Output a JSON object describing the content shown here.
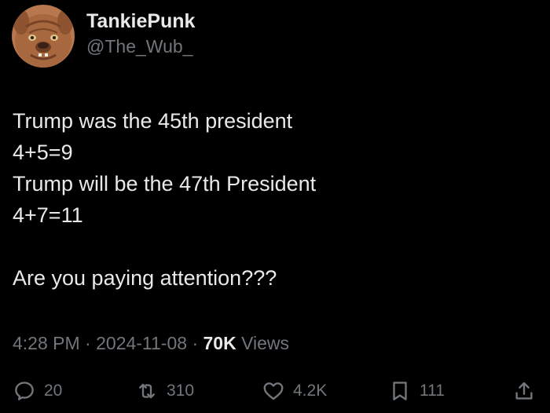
{
  "author": {
    "display_name": "TankiePunk",
    "handle": "@The_Wub_"
  },
  "tweet": {
    "lines": [
      "Trump was the 45th president",
      "4+5=9",
      "Trump will be the 47th President",
      "4+7=11",
      "",
      "Are you paying attention???"
    ]
  },
  "meta": {
    "time": "4:28 PM",
    "separator": "·",
    "date": "2024-11-08",
    "views_count": "70K",
    "views_label": "Views"
  },
  "actions": {
    "replies": "20",
    "reposts": "310",
    "likes": "4.2K",
    "bookmarks": "111"
  },
  "icons": {
    "reply": "reply-icon",
    "repost": "repost-icon",
    "like": "heart-icon",
    "bookmark": "bookmark-icon",
    "share": "share-icon"
  },
  "colors": {
    "background": "#000000",
    "text_primary": "#e7e9ea",
    "text_secondary": "#71767b"
  }
}
